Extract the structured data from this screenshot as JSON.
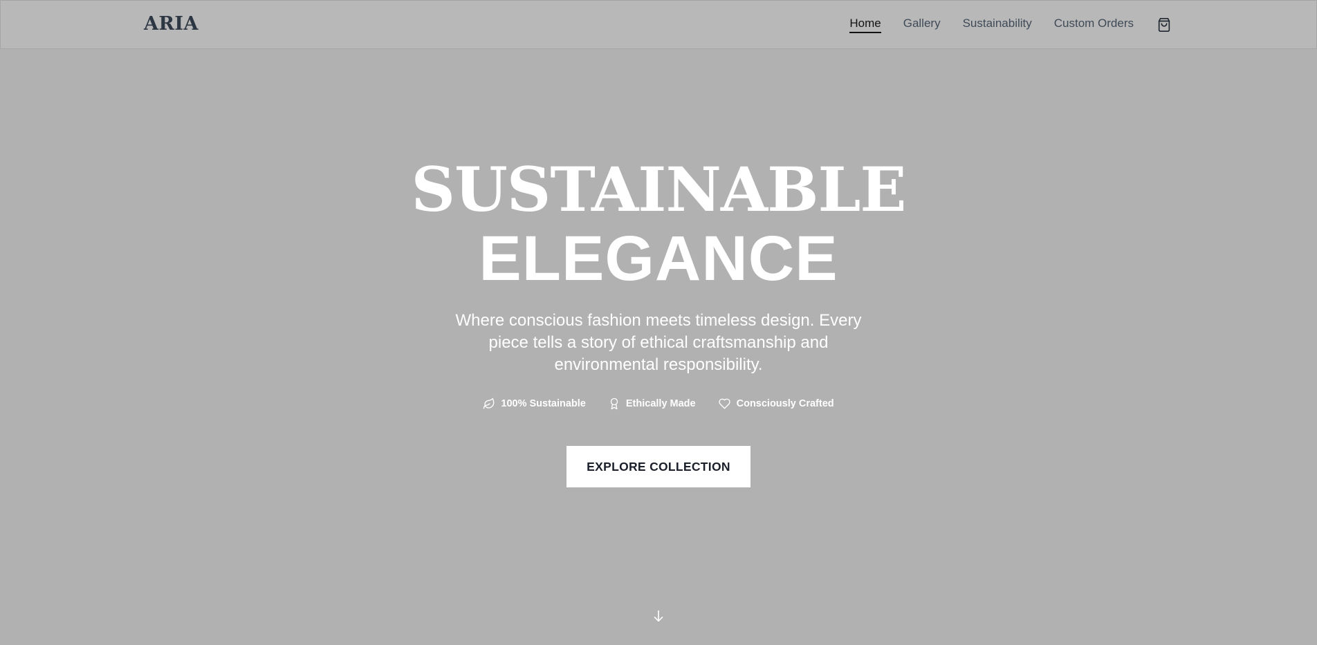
{
  "brand": {
    "logo": "ARIA"
  },
  "nav": {
    "items": [
      {
        "label": "Home",
        "active": true
      },
      {
        "label": "Gallery",
        "active": false
      },
      {
        "label": "Sustainability",
        "active": false
      },
      {
        "label": "Custom Orders",
        "active": false
      }
    ],
    "cart_icon": "shopping-bag-icon"
  },
  "hero": {
    "title_line1": "SUSTAINABLE",
    "title_line2": "ELEGANCE",
    "subtitle": "Where conscious fashion meets timeless design. Every piece tells a story of ethical craftsmanship and environmental responsibility.",
    "badges": [
      {
        "icon": "leaf-icon",
        "label": "100% Sustainable"
      },
      {
        "icon": "award-icon",
        "label": "Ethically Made"
      },
      {
        "icon": "heart-icon",
        "label": "Consciously Crafted"
      }
    ],
    "cta_label": "EXPLORE COLLECTION",
    "scroll_icon": "arrow-down-icon"
  },
  "colors": {
    "background": "#b1b1b1",
    "header_bg": "#b8b8b8",
    "logo": "#2d3743",
    "nav_text": "#3f4a57",
    "nav_active": "#121212",
    "hero_text": "#ffffff",
    "cta_bg": "#ffffff",
    "cta_text": "#1a1f2a"
  }
}
